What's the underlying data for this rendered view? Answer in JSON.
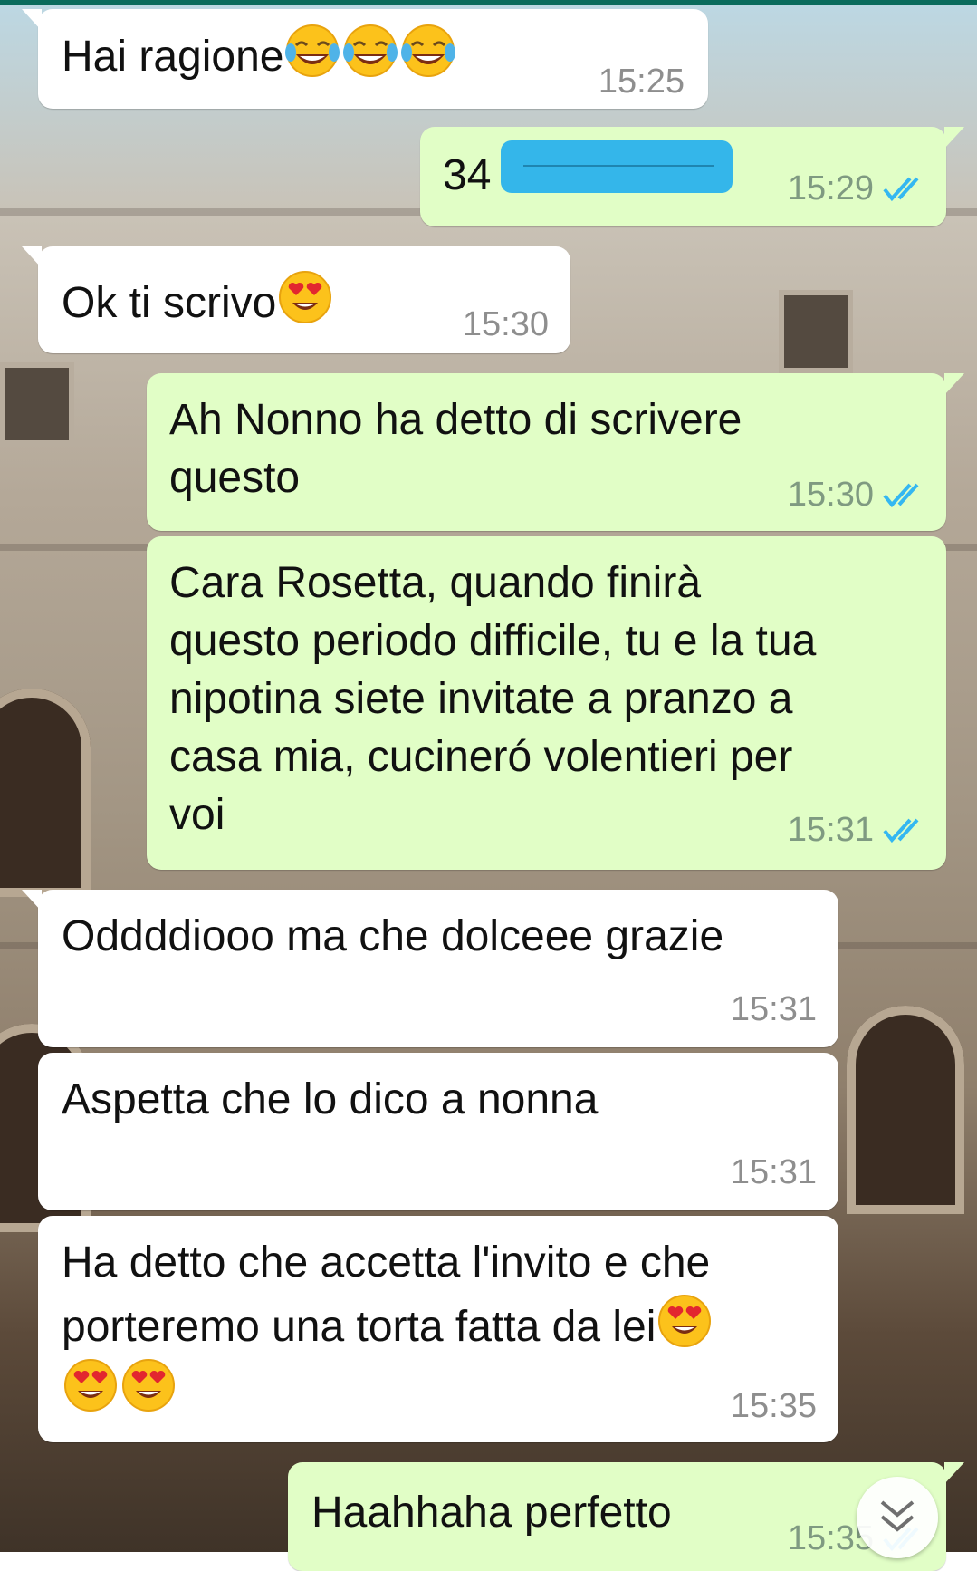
{
  "messages": [
    {
      "direction": "in",
      "text": "Hai ragione",
      "emoji": [
        "face-with-tears-of-joy",
        "face-with-tears-of-joy",
        "face-with-tears-of-joy"
      ],
      "time": "15:25"
    },
    {
      "direction": "out",
      "text": "34",
      "redacted": true,
      "time": "15:29",
      "status": "read"
    },
    {
      "direction": "in",
      "text": "Ok ti scrivo",
      "emoji": [
        "heart-eyes"
      ],
      "time": "15:30"
    },
    {
      "direction": "out",
      "lines": [
        "Ah Nonno ha detto di scrivere",
        "questo"
      ],
      "time": "15:30",
      "status": "read"
    },
    {
      "direction": "out",
      "lines": [
        "Cara Rosetta, quando finirà",
        "questo periodo difficile, tu e la tua",
        "nipotina siete invitate a pranzo a",
        "casa mia, cucineró volentieri per",
        "voi"
      ],
      "time": "15:31",
      "status": "read"
    },
    {
      "direction": "in",
      "text": "Oddddiooo ma che dolceee grazie",
      "time": "15:31"
    },
    {
      "direction": "in",
      "text": "Aspetta che lo dico a nonna",
      "time": "15:31"
    },
    {
      "direction": "in",
      "lines": [
        "Ha detto che accetta l'invito e che",
        "porteremo una torta fatta da lei"
      ],
      "emoji": [
        "heart-eyes",
        "heart-eyes",
        "heart-eyes"
      ],
      "time": "15:35"
    },
    {
      "direction": "out",
      "text": "Haahhaha perfetto",
      "time": "15:35",
      "status": "read"
    }
  ],
  "colors": {
    "incoming_bubble": "#ffffff",
    "outgoing_bubble": "#e1fec6",
    "read_ticks": "#34b7f1",
    "top_bar": "#0a6b5c"
  },
  "icons": {
    "read_status": "double-check-icon",
    "scroll_down": "double-chevron-down-icon"
  }
}
